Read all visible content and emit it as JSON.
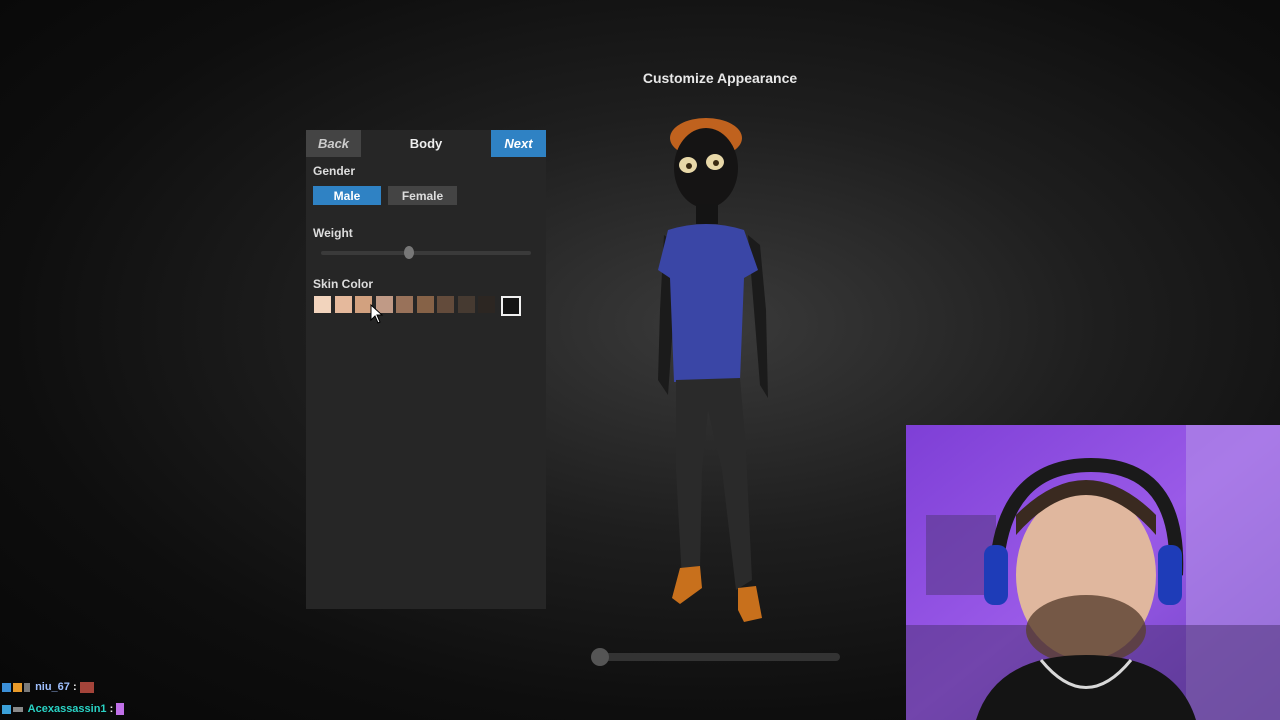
{
  "screen": {
    "title": "Customize Appearance"
  },
  "panel": {
    "back_label": "Back",
    "section_title": "Body",
    "next_label": "Next",
    "gender": {
      "label": "Gender",
      "options": [
        "Male",
        "Female"
      ],
      "selected": "Male"
    },
    "weight": {
      "label": "Weight",
      "value_fraction": 0.42
    },
    "skin_color": {
      "label": "Skin Color",
      "swatches": [
        "#f2d4bd",
        "#e5b99c",
        "#d2a17f",
        "#c09a86",
        "#99725a",
        "#866247",
        "#634b3b",
        "#463a31",
        "#2c2622",
        "#141414"
      ],
      "selected_index": 9
    }
  },
  "preview": {
    "rotation_fraction": 0.0
  },
  "chat": [
    {
      "user": "niu_67",
      "separator": ":",
      "emote": "brick-emote"
    },
    {
      "user": "Acexassassin1",
      "separator": ":",
      "emote": "feather-emote"
    }
  ],
  "colors": {
    "accent": "#2f82c4",
    "panel": "#262626",
    "button": "#444444"
  }
}
